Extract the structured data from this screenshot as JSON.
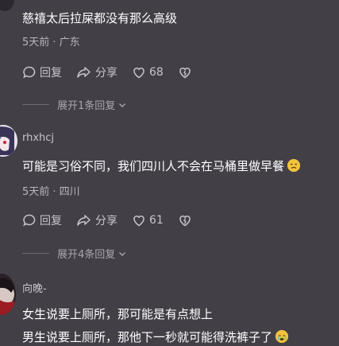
{
  "comment1": {
    "text": "慈禧太后拉屎都没有那么高级",
    "meta": "5天前 · 广东",
    "reply_label": "回复",
    "share_label": "分享",
    "likes": "68",
    "expand_label": "展开1条回复"
  },
  "comment2": {
    "username": "rhxhcj",
    "text": "可能是习俗不同，我们四川人不会在马桶里做早餐",
    "meta": "5天前 · 四川",
    "reply_label": "回复",
    "share_label": "分享",
    "likes": "61",
    "expand_label": "展开4条回复"
  },
  "comment3": {
    "username": "向晚-",
    "line1": "女生说要上厕所，那可能是有点想上",
    "line2": "男生说要上厕所，那他下一秒就可能得洗裤子了"
  }
}
